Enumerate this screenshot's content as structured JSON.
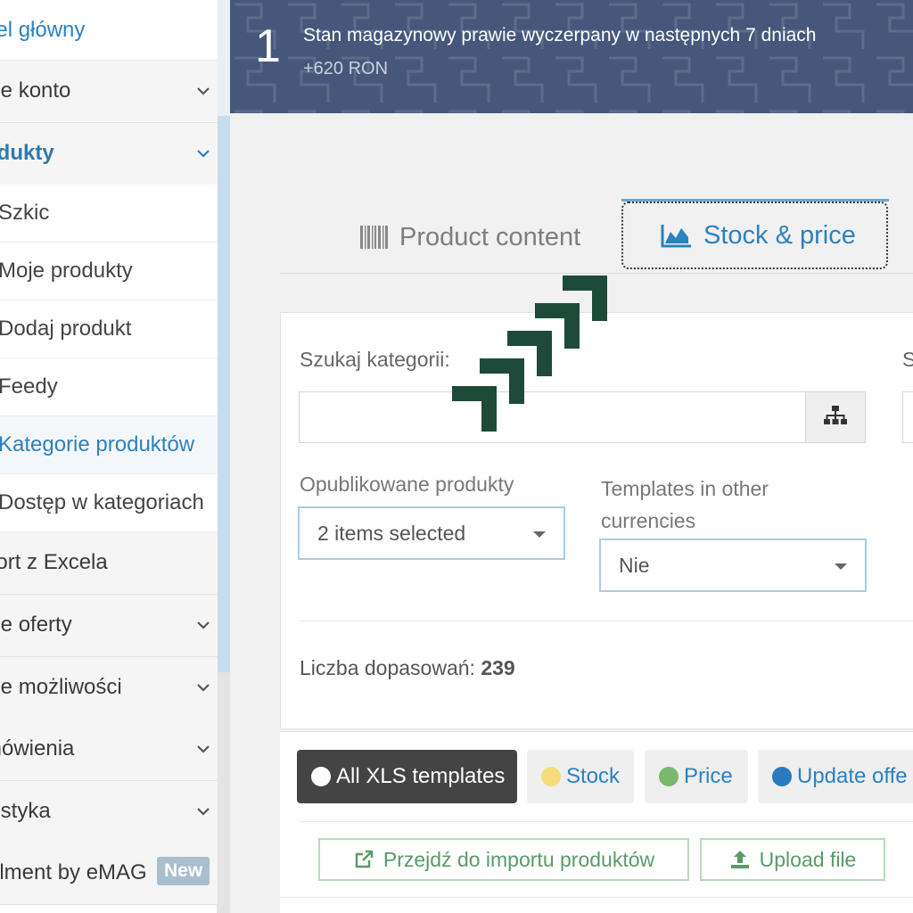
{
  "sidebar": {
    "items": [
      {
        "label": "nel główny"
      },
      {
        "label": "oje konto"
      },
      {
        "label": "odukty"
      },
      {
        "label": "port z Excela"
      },
      {
        "label": "oje oferty"
      },
      {
        "label": "oje możliwości"
      },
      {
        "label": "mówienia"
      },
      {
        "label": "gistyka"
      },
      {
        "label": "lfilment by eMAG"
      }
    ],
    "subitems": [
      {
        "label": "Szkic"
      },
      {
        "label": "Moje produkty"
      },
      {
        "label": "Dodaj produkt"
      },
      {
        "label": "Feedy"
      },
      {
        "label": "Kategorie produktów"
      },
      {
        "label": "Dostęp w kategoriach"
      }
    ],
    "badge_new": "New"
  },
  "banner": {
    "number": "1",
    "title": "Stan magazynowy prawie wyczerpany w następnych 7 dniach",
    "subtitle": "+620 RON"
  },
  "tabs": {
    "product_content": "Product content",
    "stock_price": "Stock & price"
  },
  "filters": {
    "search_label": "Szukaj kategorii:",
    "second_label_fragment": "S",
    "published_label": "Opublikowane produkty",
    "published_value": "2 items selected",
    "templates_label": "Templates in other currencies",
    "templates_value": "Nie",
    "match_label": "Liczba dopasowań:",
    "match_count": "239"
  },
  "chips": {
    "all": "All XLS templates",
    "stock": "Stock",
    "price": "Price",
    "update": "Update offe"
  },
  "actions": {
    "import": "Przejdź do importu produktów",
    "upload": "Upload file"
  },
  "colors": {
    "accent": "#2a82bf",
    "banner": "#45577b",
    "stock_dot": "#f7dc7a",
    "price_dot": "#7ab86e",
    "update_dot": "#2a7ac0",
    "arrow": "#1e4a3a"
  }
}
